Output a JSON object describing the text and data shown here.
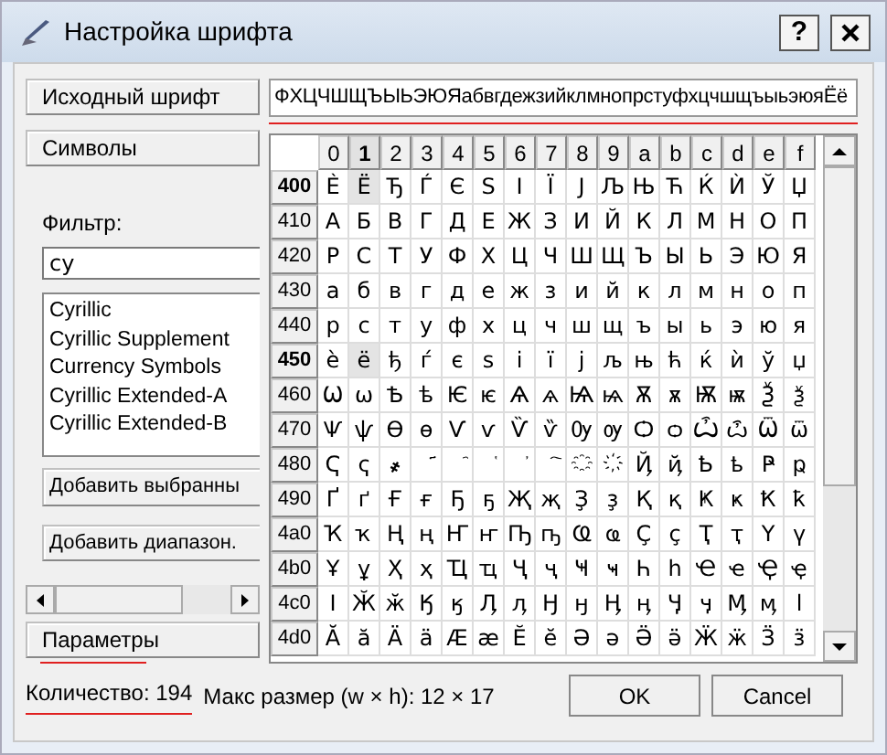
{
  "window": {
    "title": "Настройка шрифта",
    "help_button": "?"
  },
  "source_font_button": "Исходный шрифт",
  "source_text": {
    "value": "ФХЦЧШЩЪЫЬЭЮЯабвгдежзийклмнопрстуфхцчшщъыьэюяЁё",
    "underlined": true
  },
  "symbols_button": "Символы",
  "filter": {
    "label": "Фильтр:",
    "value": "су"
  },
  "blocks": [
    "Cyrillic",
    "Cyrillic Supplement",
    "Currency Symbols",
    "Cyrillic Extended-A",
    "Cyrillic Extended-B"
  ],
  "add_selected_button": "Добавить выбранны",
  "add_range_button": "Добавить диапазон.",
  "params_button": {
    "label": "Параметры",
    "underlined": true
  },
  "grid": {
    "columns": [
      {
        "label": "0",
        "selected": false
      },
      {
        "label": "1",
        "selected": true
      },
      {
        "label": "2",
        "selected": false
      },
      {
        "label": "3",
        "selected": false
      },
      {
        "label": "4",
        "selected": false
      },
      {
        "label": "5",
        "selected": false
      },
      {
        "label": "6",
        "selected": false
      },
      {
        "label": "7",
        "selected": false
      },
      {
        "label": "8",
        "selected": false
      },
      {
        "label": "9",
        "selected": false
      },
      {
        "label": "a",
        "selected": false
      },
      {
        "label": "b",
        "selected": false
      },
      {
        "label": "c",
        "selected": false
      },
      {
        "label": "d",
        "selected": false
      },
      {
        "label": "e",
        "selected": false
      },
      {
        "label": "f",
        "selected": false
      }
    ],
    "rows": [
      {
        "label": "400",
        "selected": true,
        "cells": [
          "Ѐ",
          "Ё",
          "Ђ",
          "Ѓ",
          "Є",
          "Ѕ",
          "І",
          "Ї",
          "Ј",
          "Љ",
          "Њ",
          "Ћ",
          "Ќ",
          "Ѝ",
          "Ў",
          "Џ"
        ]
      },
      {
        "label": "410",
        "selected": false,
        "cells": [
          "А",
          "Б",
          "В",
          "Г",
          "Д",
          "Е",
          "Ж",
          "З",
          "И",
          "Й",
          "К",
          "Л",
          "М",
          "Н",
          "О",
          "П"
        ]
      },
      {
        "label": "420",
        "selected": false,
        "cells": [
          "Р",
          "С",
          "Т",
          "У",
          "Ф",
          "Х",
          "Ц",
          "Ч",
          "Ш",
          "Щ",
          "Ъ",
          "Ы",
          "Ь",
          "Э",
          "Ю",
          "Я"
        ]
      },
      {
        "label": "430",
        "selected": false,
        "cells": [
          "а",
          "б",
          "в",
          "г",
          "д",
          "е",
          "ж",
          "з",
          "и",
          "й",
          "к",
          "л",
          "м",
          "н",
          "о",
          "п"
        ]
      },
      {
        "label": "440",
        "selected": false,
        "cells": [
          "р",
          "с",
          "т",
          "у",
          "ф",
          "х",
          "ц",
          "ч",
          "ш",
          "щ",
          "ъ",
          "ы",
          "ь",
          "э",
          "ю",
          "я"
        ]
      },
      {
        "label": "450",
        "selected": true,
        "cells": [
          "ѐ",
          "ё",
          "ђ",
          "ѓ",
          "є",
          "ѕ",
          "і",
          "ї",
          "ј",
          "љ",
          "њ",
          "ћ",
          "ќ",
          "ѝ",
          "ў",
          "џ"
        ]
      },
      {
        "label": "460",
        "selected": false,
        "cells": [
          "Ѡ",
          "ѡ",
          "Ѣ",
          "ѣ",
          "Ѥ",
          "ѥ",
          "Ѧ",
          "ѧ",
          "Ѩ",
          "ѩ",
          "Ѫ",
          "ѫ",
          "Ѭ",
          "ѭ",
          "Ѯ",
          "ѯ"
        ]
      },
      {
        "label": "470",
        "selected": false,
        "cells": [
          "Ѱ",
          "ѱ",
          "Ѳ",
          "ѳ",
          "Ѵ",
          "ѵ",
          "Ѷ",
          "ѷ",
          "Ѹ",
          "ѹ",
          "Ѻ",
          "ѻ",
          "Ѽ",
          "ѽ",
          "Ѿ",
          "ѿ"
        ]
      },
      {
        "label": "480",
        "selected": false,
        "cells": [
          "Ҁ",
          "ҁ",
          "҂",
          "҃",
          "҄",
          "҅",
          "҆",
          "҇",
          "҈",
          "҉",
          "Ҋ",
          "ҋ",
          "Ҍ",
          "ҍ",
          "Ҏ",
          "ҏ"
        ]
      },
      {
        "label": "490",
        "selected": false,
        "cells": [
          "Ґ",
          "ґ",
          "Ғ",
          "ғ",
          "Ҕ",
          "ҕ",
          "Җ",
          "җ",
          "Ҙ",
          "ҙ",
          "Қ",
          "қ",
          "Ҝ",
          "ҝ",
          "Ҟ",
          "ҟ"
        ]
      },
      {
        "label": "4a0",
        "selected": false,
        "cells": [
          "Ҡ",
          "ҡ",
          "Ң",
          "ң",
          "Ҥ",
          "ҥ",
          "Ҧ",
          "ҧ",
          "Ҩ",
          "ҩ",
          "Ҫ",
          "ҫ",
          "Ҭ",
          "ҭ",
          "Ү",
          "ү"
        ]
      },
      {
        "label": "4b0",
        "selected": false,
        "cells": [
          "Ұ",
          "ұ",
          "Ҳ",
          "ҳ",
          "Ҵ",
          "ҵ",
          "Ҷ",
          "ҷ",
          "Ҹ",
          "ҹ",
          "Һ",
          "һ",
          "Ҽ",
          "ҽ",
          "Ҿ",
          "ҿ"
        ]
      },
      {
        "label": "4c0",
        "selected": false,
        "cells": [
          "Ӏ",
          "Ӂ",
          "ӂ",
          "Ӄ",
          "ӄ",
          "Ӆ",
          "ӆ",
          "Ӈ",
          "ӈ",
          "Ӊ",
          "ӊ",
          "Ӌ",
          "ӌ",
          "Ӎ",
          "ӎ",
          "ӏ"
        ]
      },
      {
        "label": "4d0",
        "selected": false,
        "cells": [
          "Ӑ",
          "ӑ",
          "Ӓ",
          "ӓ",
          "Ӕ",
          "ӕ",
          "Ӗ",
          "ӗ",
          "Ә",
          "ә",
          "Ӛ",
          "ӛ",
          "Ӝ",
          "ӝ",
          "Ӟ",
          "ӟ"
        ]
      }
    ]
  },
  "status": {
    "count": {
      "text": "Количество: 194",
      "underlined": true
    },
    "size": "Макс размер (w × h): 12 × 17"
  },
  "buttons": [
    "OK",
    "Cancel"
  ]
}
